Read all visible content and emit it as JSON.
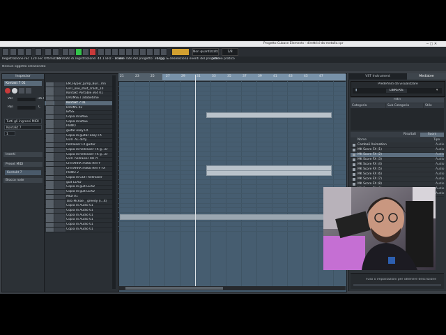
{
  "title_bar": {
    "window_title": "Progetto Cubase Elements - direttrici-da-metallo.cpr"
  },
  "menu": {
    "items": [
      "File",
      "Modifica",
      "Progetto",
      "Audio",
      "MIDI",
      "Media",
      "Trasporto",
      "Periferiche",
      "Finestra",
      "Aiuto",
      "Steinberg Hub"
    ]
  },
  "toolbar": {
    "tempo_box": "Non quantizzato",
    "snap_box": "1/8"
  },
  "info_line": {
    "left": "Registrazione rec",
    "mid": "120 sec Ottimizzati",
    "mid2": "Formato di registrazione: 44.1 kHz - 16 Bit",
    "mid3": "Frame rate del progetto: 30 fps",
    "right": "Leggi & deseleziona eventi del progetto",
    "right2": "Stereo pratico"
  },
  "status": {
    "text": "Nessun oggetto selezionato"
  },
  "inspector": {
    "title": "Inspector",
    "track_name": "Kontakt 7 01",
    "routing_in": "Tutti gli ingressi MIDI",
    "routing_out": "Kontakt 7",
    "chan": "1",
    "section_insert": "Inserti",
    "section_send": "Preset MIDI",
    "section_kontakt": "Kontakt 7",
    "section_note": "Blocco note",
    "vol_label": "Vol",
    "pan_label": "Pan",
    "vol_val": "-16.0",
    "pan_val": "C"
  },
  "tracks": [
    "EM_Hyper_Jump_Buil...mn",
    "GHT_one_shot_crash_10",
    "Kontakt Portable x64 01",
    "DRUMSET adobetime",
    "Kontakt 7 01",
    "DRUMS 02",
    "BASS",
    "Copia di BASS",
    "Copia di BASS",
    "PIANO",
    "guitar easy FX",
    "Copia di guitar easy FX",
    "GUIT AC dirty",
    "hellraiser FX guitar",
    "Copia di hellraiser FX g...ar",
    "Copia di hellraiser FX g...ar",
    "GUIT hellraiser RHTY",
    "CHITARRA metal RHTY",
    "CHITARRA metal RHTY FX",
    "PIANO 2",
    "Copia di GUIT hellraiser",
    "guit LEAD",
    "Copia di guit LEAD",
    "Copia di guit LEAD",
    "MIDI 01",
    "Tato McRae _ greedy (i...lt)",
    "Copia di Audio 01",
    "Copia di Audio 01",
    "Copia di Audio 01",
    "Copia di Audio 01",
    "Copia di Audio 01",
    "Copia di Audio 01"
  ],
  "ruler": {
    "bars": [
      "21",
      "23",
      "25",
      "27",
      "29",
      "31",
      "33",
      "35",
      "37",
      "39",
      "41",
      "43",
      "45",
      "47"
    ]
  },
  "right_panel": {
    "tab_vst": "VST Instrument",
    "tab_media": "Mediatee",
    "preset_header": "Predefiniti da visualizzare",
    "preset_value": "LIBRERIE",
    "filter_header": "Filtri",
    "columns": [
      "Categoria",
      "Sub Categoria",
      "Stile"
    ],
    "results_tabs": [
      "Risultati",
      "Suoni"
    ],
    "result_cols": [
      "Nome",
      "Tipo"
    ],
    "results": [
      {
        "name": "Cambali Animation",
        "type": "Audio"
      },
      {
        "name": "MK Score FX (1)",
        "type": "Audio"
      },
      {
        "name": "MK Score FX (2)",
        "type": "Audio"
      },
      {
        "name": "MK Score FX (3)",
        "type": "Audio"
      },
      {
        "name": "MK Score FX (4)",
        "type": "Audio"
      },
      {
        "name": "MK Score FX (5)",
        "type": "Audio"
      },
      {
        "name": "MK Score FX (6)",
        "type": "Audio"
      },
      {
        "name": "MK Score FX (7)",
        "type": "Audio"
      },
      {
        "name": "MK Score FX (8)",
        "type": "Audio"
      },
      {
        "name": "MK Score FX (9)",
        "type": "Audio"
      },
      {
        "name": "MK Score FX (10)",
        "type": "Audio"
      }
    ],
    "preview_hint": "Fuso o impostazioni per ottenere descrizione"
  },
  "colors": {
    "accent_green": "#33c34a",
    "selection": "#5a6b7a",
    "grid_bg": "#465d70"
  }
}
